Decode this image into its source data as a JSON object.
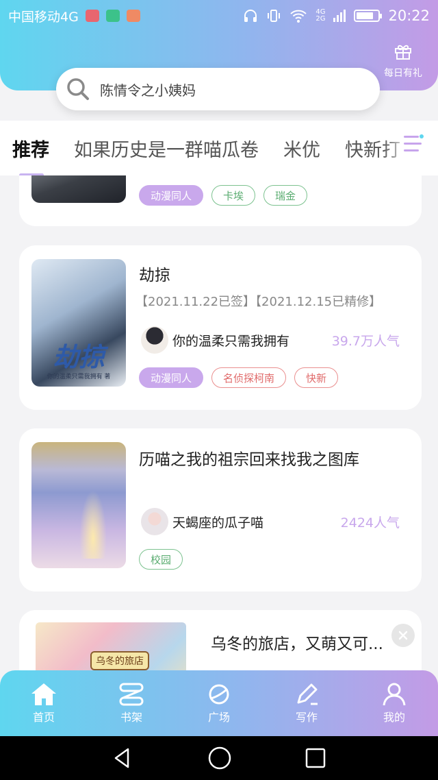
{
  "status_bar": {
    "carrier": "中国移动4G",
    "time": "20:22",
    "network_small": [
      "4G",
      "2G"
    ],
    "battery_level_percent": 80
  },
  "header": {
    "gift_label": "每日有礼",
    "search_text": "陈情令之小姨妈"
  },
  "tabs": [
    "推荐",
    "如果历史是一群喵瓜卷",
    "米优",
    "快新打"
  ],
  "cards": [
    {
      "tags": [
        {
          "label": "动漫同人",
          "style": "purple"
        },
        {
          "label": "卡埃",
          "style": "green"
        },
        {
          "label": "瑞金",
          "style": "green"
        }
      ]
    },
    {
      "title": "劫掠",
      "subtitle": "【2021.11.22已签】【2021.12.15已精修】",
      "cover_text": "劫掠",
      "cover_caption": "你的温柔只需我拥有 著",
      "author": "你的温柔只需我拥有",
      "popularity": "39.7万人气",
      "tags": [
        {
          "label": "动漫同人",
          "style": "purple"
        },
        {
          "label": "名侦探柯南",
          "style": "red"
        },
        {
          "label": "快新",
          "style": "red"
        }
      ]
    },
    {
      "title": "历喵之我的祖宗回来找我之图库",
      "author": "天蝎座的瓜子喵",
      "popularity": "2424人气",
      "tags": [
        {
          "label": "校园",
          "style": "green"
        }
      ]
    },
    {
      "title": "乌冬的旅店，又萌又可...",
      "cover_text": "乌冬的旅店"
    }
  ],
  "bottom_nav": [
    {
      "label": "首页",
      "icon": "home-icon"
    },
    {
      "label": "书架",
      "icon": "bookshelf-icon"
    },
    {
      "label": "广场",
      "icon": "planet-icon"
    },
    {
      "label": "写作",
      "icon": "pen-icon"
    },
    {
      "label": "我的",
      "icon": "user-icon"
    }
  ],
  "colors": {
    "gradient_start": "#5fd6ef",
    "gradient_end": "#c39be6",
    "popularity": "#c8a7ec"
  }
}
